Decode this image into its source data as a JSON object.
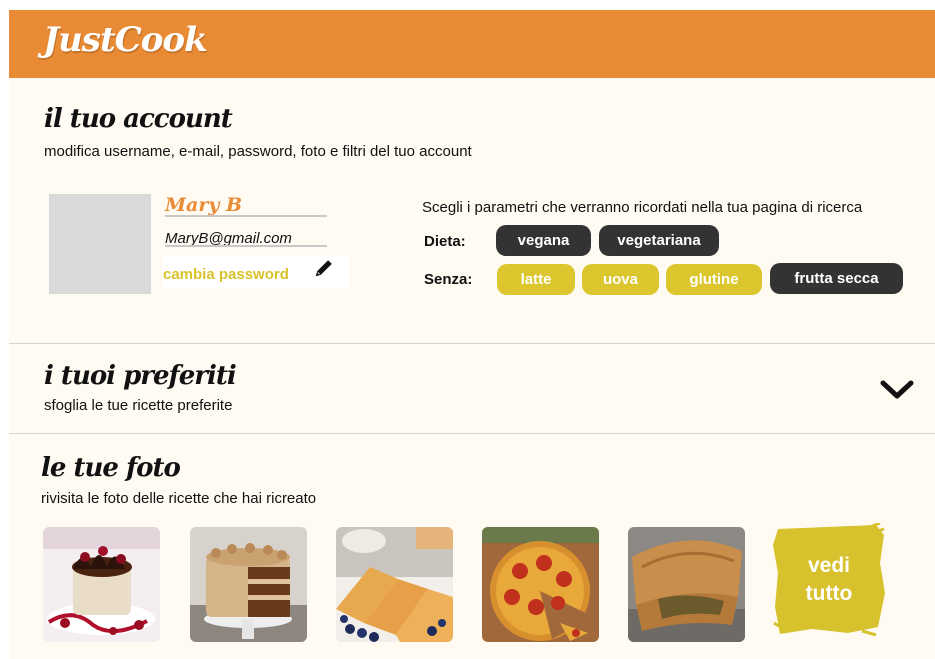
{
  "brand": {
    "name": "JustCook",
    "color": "#e98a35"
  },
  "account": {
    "title": "il tuo account",
    "subtitle": "modifica username, e-mail, password, foto e filtri del tuo account",
    "username": "Mary B",
    "email": "MaryB@gmail.com",
    "change_password": "cambia password",
    "edit_icon": "pencil-icon",
    "prefs_intro": "Scegli i parametri che verranno ricordati nella tua pagina di ricerca",
    "diet_label": "Dieta:",
    "diet_chips": [
      "vegana",
      "vegetariana"
    ],
    "without_label": "Senza:",
    "without_chips": [
      "latte",
      "uova",
      "glutine",
      "frutta secca"
    ]
  },
  "favorites": {
    "title": "i tuoi preferiti",
    "subtitle": "sfoglia le tue ricette preferite",
    "toggle_icon": "chevron-down-icon"
  },
  "photos": {
    "title": "le tue foto",
    "subtitle": "rivisita le foto delle ricette che hai ricreato",
    "items": [
      "chocolate-mousse-cake-photo",
      "layer-cake-photo",
      "crepes-photo",
      "pizza-photo",
      "calzone-photo"
    ],
    "see_all": "vedi tutto"
  },
  "colors": {
    "accent_orange": "#e98a35",
    "chip_yellow": "#dcc62d",
    "chip_dark": "#333333",
    "panel": "#fffbf3"
  }
}
